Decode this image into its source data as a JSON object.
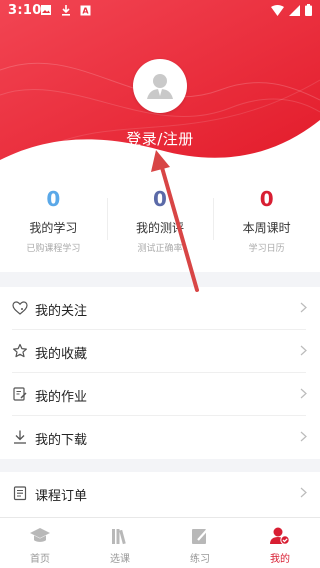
{
  "status_bar": {
    "time": "3:10",
    "left_icons": [
      "image-icon",
      "download-icon",
      "a-badge-icon"
    ],
    "right_icons": [
      "wifi-icon",
      "signal-icon",
      "battery-icon"
    ]
  },
  "header": {
    "login_label": "登录/注册",
    "avatar_icon": "user-avatar-icon",
    "gradient": [
      "#f0414c",
      "#e8212f"
    ]
  },
  "stats": [
    {
      "value": "0",
      "title": "我的学习",
      "subtitle": "已购课程学习",
      "color": "#5aa8e8"
    },
    {
      "value": "0",
      "title": "我的测评",
      "subtitle": "测试正确率",
      "color": "#5b6aa8"
    },
    {
      "value": "0",
      "title": "本周课时",
      "subtitle": "学习日历",
      "color": "#d81e32"
    }
  ],
  "menu": [
    {
      "label": "我的关注",
      "icon": "heart-outline-icon"
    },
    {
      "label": "我的收藏",
      "icon": "star-outline-icon"
    },
    {
      "label": "我的作业",
      "icon": "homework-icon"
    },
    {
      "label": "我的下载",
      "icon": "download-icon"
    }
  ],
  "menu2": [
    {
      "label": "课程订单",
      "icon": "order-list-icon"
    }
  ],
  "tabs": [
    {
      "label": "首页",
      "icon": "graduation-cap-icon",
      "active": false
    },
    {
      "label": "选课",
      "icon": "books-icon",
      "active": false
    },
    {
      "label": "练习",
      "icon": "pencil-note-icon",
      "active": false
    },
    {
      "label": "我的",
      "icon": "user-check-icon",
      "active": true
    }
  ],
  "colors": {
    "accent": "#d81e32",
    "annotation_arrow": "#d84545"
  }
}
